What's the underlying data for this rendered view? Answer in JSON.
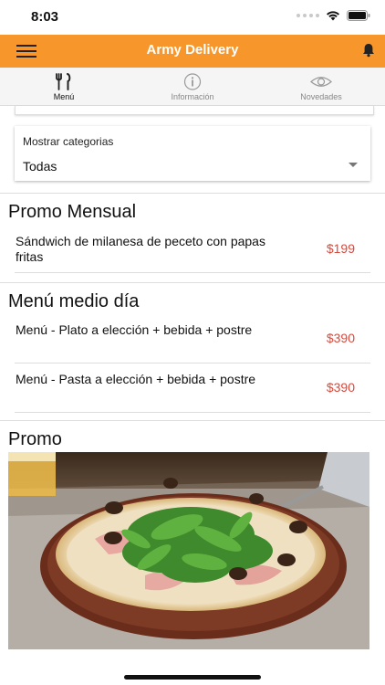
{
  "status_bar": {
    "time": "8:03"
  },
  "app_bar": {
    "title": "Army Delivery"
  },
  "tabs": [
    {
      "label": "Menú",
      "icon": "cutlery-icon",
      "active": true
    },
    {
      "label": "Información",
      "icon": "info-icon",
      "active": false
    },
    {
      "label": "Novedades",
      "icon": "eye-icon",
      "active": false
    }
  ],
  "category_select": {
    "label": "Mostrar categorias",
    "value": "Todas"
  },
  "sections": [
    {
      "title": "Promo Mensual",
      "items": [
        {
          "name": "Sándwich de milanesa de peceto con papas fritas",
          "price": "$199"
        }
      ]
    },
    {
      "title": "Menú medio día",
      "items": [
        {
          "name": "Menú - Plato a elección + bebida + postre",
          "price": "$390"
        },
        {
          "name": "Menú - Pasta a elección + bebida + postre",
          "price": "$390"
        }
      ]
    },
    {
      "title": "Promo",
      "image": "pizza-photo"
    }
  ],
  "colors": {
    "accent": "#f7962b",
    "price": "#d94a3d"
  }
}
